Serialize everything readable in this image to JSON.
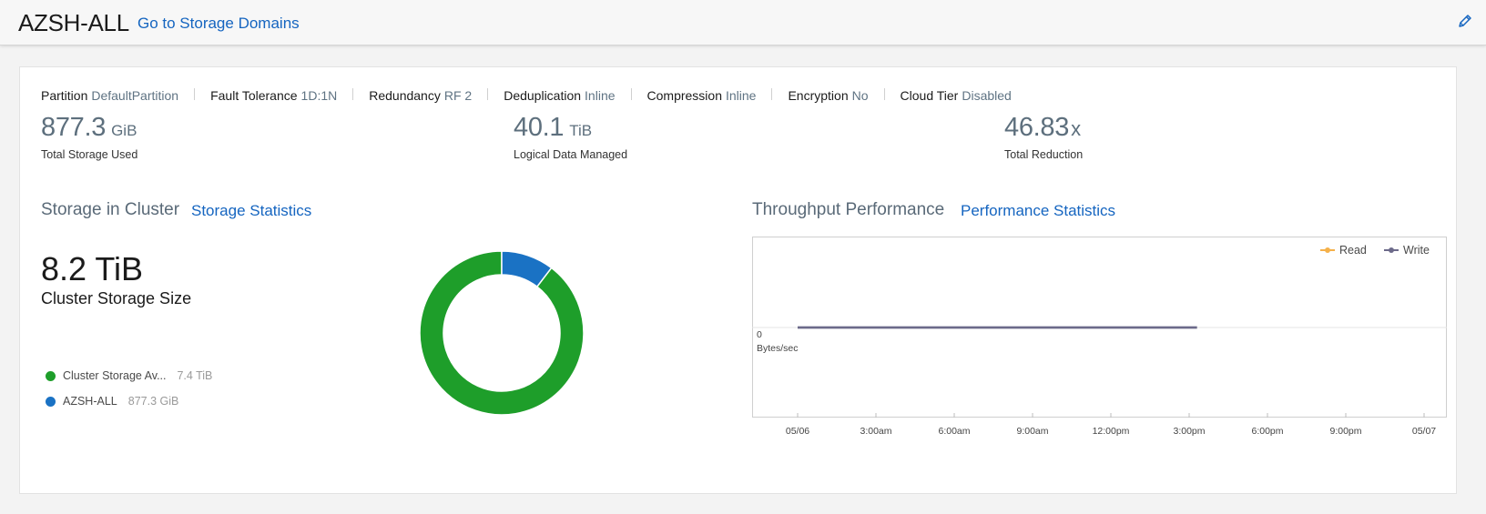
{
  "header": {
    "title": "AZSH-ALL",
    "link": "Go to Storage Domains",
    "edit_icon": "pencil-icon"
  },
  "properties": [
    {
      "key": "Partition",
      "value": "DefaultPartition"
    },
    {
      "key": "Fault Tolerance",
      "value": "1D:1N"
    },
    {
      "key": "Redundancy",
      "value": "RF 2"
    },
    {
      "key": "Deduplication",
      "value": "Inline"
    },
    {
      "key": "Compression",
      "value": "Inline"
    },
    {
      "key": "Encryption",
      "value": "No"
    },
    {
      "key": "Cloud Tier",
      "value": "Disabled"
    }
  ],
  "metrics": {
    "storage_used": {
      "value": "877.3",
      "unit": "GiB",
      "label": "Total Storage Used"
    },
    "logical": {
      "value": "40.1",
      "unit": "TiB",
      "label": "Logical Data Managed"
    },
    "reduction": {
      "value": "46.83",
      "unit": "x",
      "label": "Total Reduction"
    }
  },
  "storage": {
    "title": "Storage in Cluster",
    "link": "Storage Statistics",
    "cluster_size": "8.2 TiB",
    "cluster_size_label": "Cluster Storage Size",
    "legend": [
      {
        "name": "Cluster Storage Av...",
        "value": "7.4 TiB",
        "color": "#1e9e2a"
      },
      {
        "name": "AZSH-ALL",
        "value": "877.3 GiB",
        "color": "#1a72c4"
      }
    ]
  },
  "performance": {
    "title": "Throughput Performance",
    "link": "Performance Statistics",
    "legend": [
      {
        "name": "Read",
        "color": "#f5b14a"
      },
      {
        "name": "Write",
        "color": "#6c6a8a"
      }
    ],
    "y_zero": "0",
    "y_unit": "Bytes/sec"
  },
  "chart_data": [
    {
      "type": "pie",
      "title": "",
      "categories": [
        "Cluster Storage Av...",
        "AZSH-ALL"
      ],
      "values": [
        7.4,
        0.8567
      ],
      "units": "TiB",
      "donut": true,
      "colors": [
        "#1e9e2a",
        "#1a72c4"
      ]
    },
    {
      "type": "line",
      "title": "",
      "xlabel": "",
      "ylabel": "Bytes/sec",
      "x": [
        "05/06",
        "3:00am",
        "6:00am",
        "9:00am",
        "12:00pm",
        "3:00pm",
        "6:00pm",
        "9:00pm",
        "05/07"
      ],
      "series": [
        {
          "name": "Read",
          "color": "#f5b14a",
          "points": [
            [
              0,
              0
            ],
            [
              15.3,
              0
            ]
          ]
        },
        {
          "name": "Write",
          "color": "#6c6a8a",
          "points": [
            [
              0,
              0
            ],
            [
              15.3,
              0
            ]
          ]
        }
      ],
      "xlim_hours": [
        0,
        24
      ],
      "grid": false,
      "legend": "top-right"
    }
  ]
}
